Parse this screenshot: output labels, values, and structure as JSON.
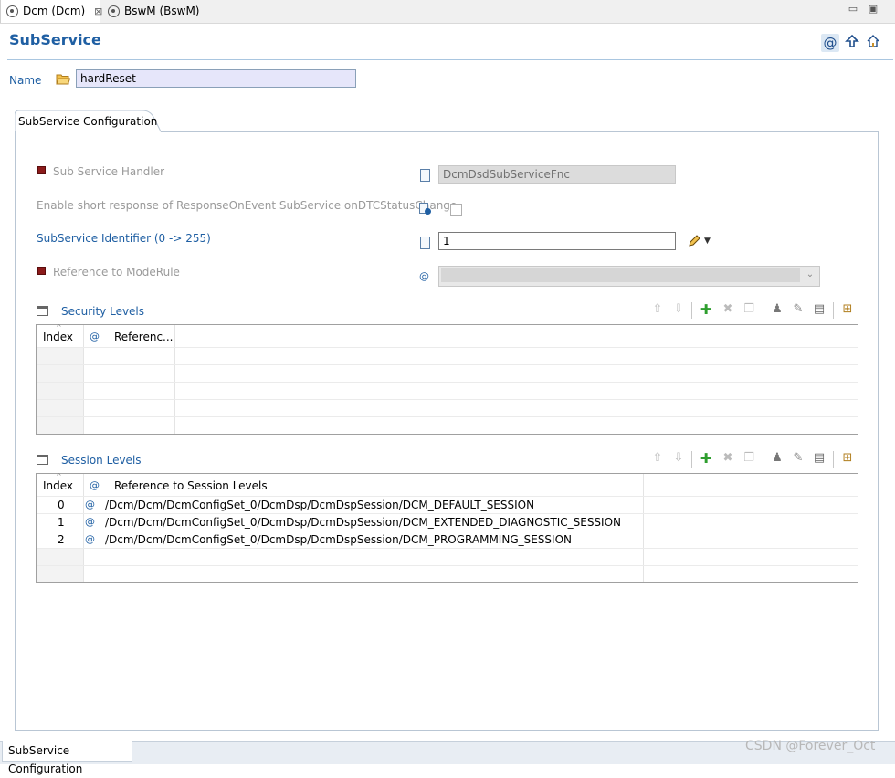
{
  "tabs": [
    {
      "label": "Dcm (Dcm)",
      "close_symbol": "⊠",
      "icon": "module-icon"
    },
    {
      "label": "BswM (BswM)",
      "icon": "module-icon"
    }
  ],
  "window_controls": {
    "minimize": "▭",
    "maximize": "▣"
  },
  "header": {
    "title": "SubService",
    "icons": [
      "at-reference-icon",
      "up-arrow-icon",
      "home-icon"
    ]
  },
  "name": {
    "label": "Name",
    "value": "hardReset"
  },
  "panel": {
    "tab_label": "SubService Configuration",
    "fields": {
      "sub_service_handler": {
        "label": "Sub Service Handler",
        "value": "DcmDsdSubServiceFnc"
      },
      "enable_short_response": {
        "label": "Enable short response of ResponseOnEvent SubService onDTCStatusChange",
        "checked": false
      },
      "subservice_identifier": {
        "label": "SubService Identifier (0 -> 255)",
        "value": "1"
      },
      "reference_to_moderule": {
        "label": "Reference to ModeRule",
        "value": ""
      }
    },
    "security_levels": {
      "title": "Security Levels",
      "columns": [
        "Index",
        "Referenc..."
      ],
      "rows": []
    },
    "session_levels": {
      "title": "Session Levels",
      "columns": [
        "Index",
        "Reference to Session Levels"
      ],
      "rows": [
        {
          "index": "0",
          "reference": "/Dcm/Dcm/DcmConfigSet_0/DcmDsp/DcmDspSession/DCM_DEFAULT_SESSION"
        },
        {
          "index": "1",
          "reference": "/Dcm/Dcm/DcmConfigSet_0/DcmDsp/DcmDspSession/DCM_EXTENDED_DIAGNOSTIC_SESSION"
        },
        {
          "index": "2",
          "reference": "/Dcm/Dcm/DcmConfigSet_0/DcmDsp/DcmDspSession/DCM_PROGRAMMING_SESSION"
        }
      ]
    },
    "table_toolbar_icons": [
      "move-up-icon",
      "move-down-icon",
      "add-icon",
      "delete-icon",
      "copy-icon",
      "user-icon",
      "edit-icon",
      "edit-table-icon",
      "import-icon"
    ]
  },
  "bottom_tab": {
    "label": "SubService Configuration"
  },
  "watermark": "CSDN @Forever_Oct",
  "colors": {
    "accent_blue": "#1f5fa3",
    "name_field_bg": "#e6e6fa",
    "disabled_gray": "#9a9a9a",
    "required_marker": "#8b1a1a",
    "add_green": "#2e9e2e"
  }
}
